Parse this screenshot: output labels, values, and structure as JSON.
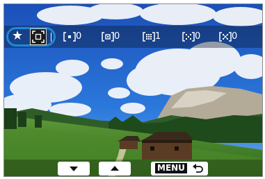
{
  "colors": {
    "sky": "#1f63cf",
    "ring": "#1c8ad8"
  },
  "scene": {
    "description_icon": "landscape-photo"
  },
  "af_bar": {
    "star_icon": "star-icon",
    "selected_icon": "af-area-icon",
    "items": [
      {
        "icon": "af-point-icon",
        "value": "0"
      },
      {
        "icon": "af-point-icon",
        "value": "0"
      },
      {
        "icon": "af-zone-icon",
        "value": "1"
      },
      {
        "icon": "af-zone-wide-icon",
        "value": "0"
      },
      {
        "icon": "af-auto-icon",
        "value": "0"
      }
    ]
  },
  "buttons": {
    "down": "chevron-down-icon",
    "up": "chevron-up-icon",
    "menu_label": "MENU",
    "return_icon": "return-icon"
  }
}
